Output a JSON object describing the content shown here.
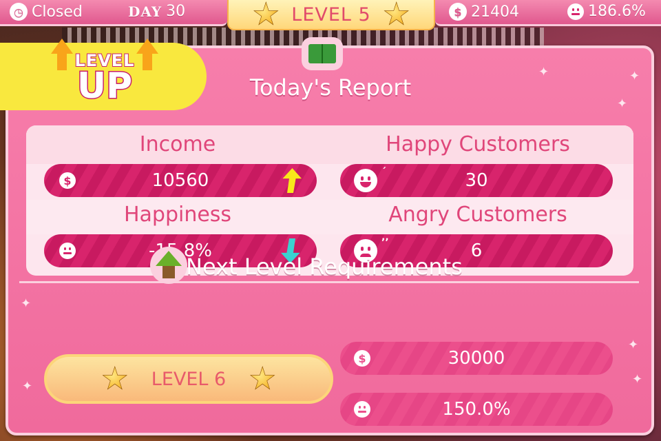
{
  "hud": {
    "status": "Closed",
    "day_label": "DAY",
    "day_value": "30",
    "level": "LEVEL 5",
    "money": "21404",
    "happiness": "186.6%"
  },
  "badge": {
    "line1": "LEVEL",
    "line2": "UP"
  },
  "report": {
    "title": "Today's Report",
    "income_label": "Income",
    "income_value": "10560",
    "income_trend": "up",
    "happy_label": "Happy Customers",
    "happy_value": "30",
    "happiness_label": "Happiness",
    "happiness_value": "-15.8%",
    "happiness_trend": "down",
    "angry_label": "Angry Customers",
    "angry_value": "6"
  },
  "requirements": {
    "title": "Next Level Requirements",
    "next_level": "LEVEL 6",
    "money": "30000",
    "happiness": "150.0%"
  },
  "colors": {
    "panel": "#f06a9c",
    "accent_dark": "#d8246c",
    "gold": "#f2a20a",
    "trend_up": "#f8e81a",
    "trend_down": "#3ad2d0"
  },
  "icons": [
    "clock-icon",
    "star-icon",
    "coin-icon",
    "smile-icon",
    "book-icon",
    "happy-face-icon",
    "sad-face-icon",
    "arrow-up-icon",
    "arrow-down-icon",
    "level-up-arrow-icon"
  ]
}
